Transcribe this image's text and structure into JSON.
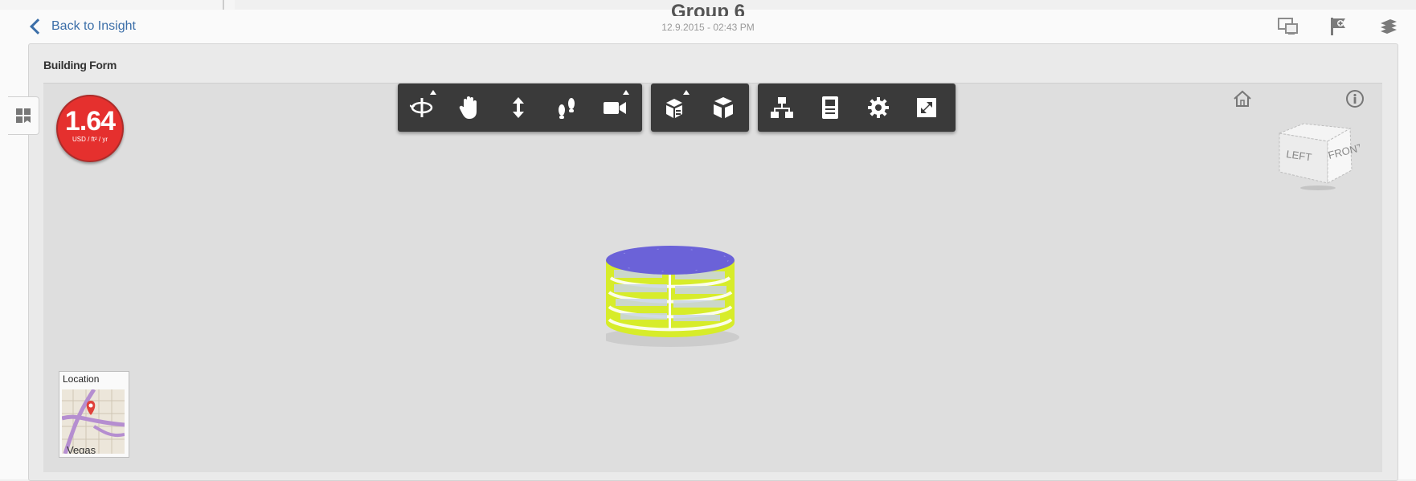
{
  "header": {
    "back_label": "Back to Insight",
    "title": "Group 6",
    "date": "12.9.2015 - 02:43 PM",
    "icons": [
      "compare-views-icon",
      "flag-add-icon",
      "layers-icon"
    ]
  },
  "card": {
    "title": "Building Form"
  },
  "cost_badge": {
    "value": "1.64",
    "unit": "USD / ft² / yr",
    "color": "#e5302e"
  },
  "view_cube": {
    "left_label": "LEFT",
    "front_label": "FRONT"
  },
  "location": {
    "label": "Location",
    "map_text": "Vegas"
  },
  "model_colors": {
    "roof": "#6b62d8",
    "facade": "#d7ec2a",
    "glazing": "#c9d4e6"
  },
  "toolbar": {
    "groups": [
      [
        "orbit-icon",
        "pan-hand-icon",
        "zoom-icon",
        "walk-icon",
        "camera-icon"
      ],
      [
        "explode-model-icon",
        "model-browser-icon"
      ],
      [
        "structure-icon",
        "properties-icon",
        "settings-icon",
        "fullscreen-icon"
      ]
    ]
  }
}
